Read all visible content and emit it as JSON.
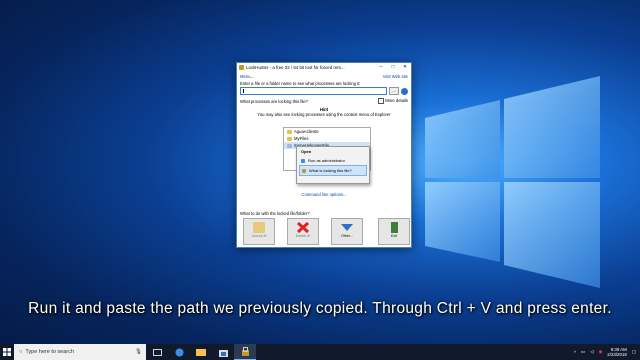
{
  "window": {
    "title": "LockHunter - a free 32 / 64 bit tool for forced rem...",
    "menu_label": "Menu...",
    "visit_label": "Visit Web site",
    "enter_label": "Enter a file or a folder name to see what processes are locking it:",
    "path_value": "",
    "browse_label": "...",
    "locking_label": "What processes are locking this file?",
    "more_details_label": "More details",
    "hint_title": "Hint",
    "hint_text": "You may also see locking processes using the context menu of Explorer",
    "tree_items": [
      "AguaAcliente",
      "MyFiles",
      "SomeUnknownFile"
    ],
    "context_menu": [
      "Open",
      "Run as administrator",
      "What is locking this file?"
    ],
    "cmdline_label": "Command line options...",
    "what_to_do_label": "What to do with the locked file/folder?",
    "buttons": [
      "Unlock It!",
      "Delete It!",
      "Other...",
      "Exit"
    ]
  },
  "caption": "Run it and paste the path we previously copied. Through Ctrl + V and press enter.",
  "taskbar": {
    "search_placeholder": "Type here to search",
    "time": "9:38 AM",
    "date": "2/23/2018"
  },
  "colors": {
    "accent": "#2f6fc8",
    "taskbar": "#101a2c"
  }
}
